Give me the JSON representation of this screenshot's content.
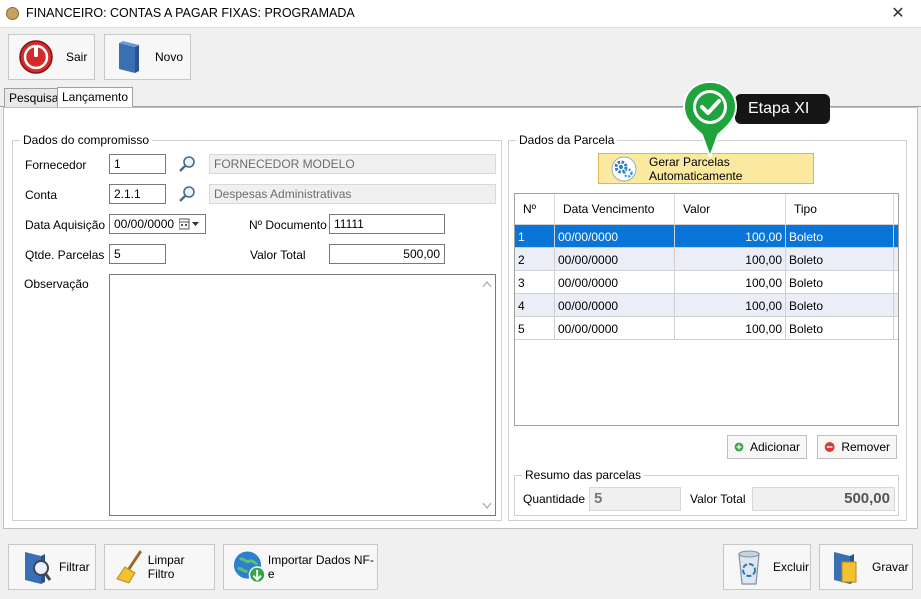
{
  "window": {
    "title": "FINANCEIRO: CONTAS A PAGAR FIXAS: PROGRAMADA",
    "close_glyph": "✕"
  },
  "toolbar": {
    "sair_label": "Sair",
    "novo_label": "Novo"
  },
  "tabs": [
    {
      "label": "Pesquisa"
    },
    {
      "label": "Lançamento"
    }
  ],
  "compromisso": {
    "legend": "Dados do compromisso",
    "fornecedor_label": "Fornecedor",
    "fornecedor_code": "1",
    "fornecedor_name": "FORNECEDOR MODELO",
    "conta_label": "Conta",
    "conta_code": "2.1.1",
    "conta_name": "Despesas Administrativas",
    "data_aquisicao_label": "Data Aquisição",
    "data_aquisicao_value": "00/00/0000",
    "documento_label": "Nº Documento",
    "documento_value": "11111",
    "parcelas_label": "Qtde. Parcelas",
    "parcelas_value": "5",
    "valor_total_label": "Valor Total",
    "valor_total_value": "500,00",
    "observacao_label": "Observação",
    "observacao_value": ""
  },
  "parcela": {
    "legend": "Dados da Parcela",
    "gerar_label": "Gerar Parcelas Automaticamente",
    "columns": [
      "Nº",
      "Data Vencimento",
      "Valor",
      "Tipo"
    ],
    "rows": [
      {
        "num": "1",
        "venc": "00/00/0000",
        "valor": "100,00",
        "tipo": "Boleto"
      },
      {
        "num": "2",
        "venc": "00/00/0000",
        "valor": "100,00",
        "tipo": "Boleto"
      },
      {
        "num": "3",
        "venc": "00/00/0000",
        "valor": "100,00",
        "tipo": "Boleto"
      },
      {
        "num": "4",
        "venc": "00/00/0000",
        "valor": "100,00",
        "tipo": "Boleto"
      },
      {
        "num": "5",
        "venc": "00/00/0000",
        "valor": "100,00",
        "tipo": "Boleto"
      }
    ],
    "adicionar_label": "Adicionar",
    "remover_label": "Remover",
    "resumo_legend": "Resumo das parcelas",
    "quantidade_label": "Quantidade",
    "quantidade_value": "5",
    "resumo_total_label": "Valor Total",
    "resumo_total_value": "500,00"
  },
  "callout": {
    "text": "Etapa XI"
  },
  "bottom": {
    "filtrar_label": "Filtrar",
    "limpar_label": "Limpar Filtro",
    "importar_label": "Importar Dados NF-e",
    "excluir_label": "Excluir",
    "gravar_label": "Gravar"
  },
  "colors": {
    "selected_row": "#0a75d8",
    "alt_row": "#ebeef7",
    "gerar_button_bg": "#fbe9a0",
    "callout_green": "#1fa33c"
  }
}
